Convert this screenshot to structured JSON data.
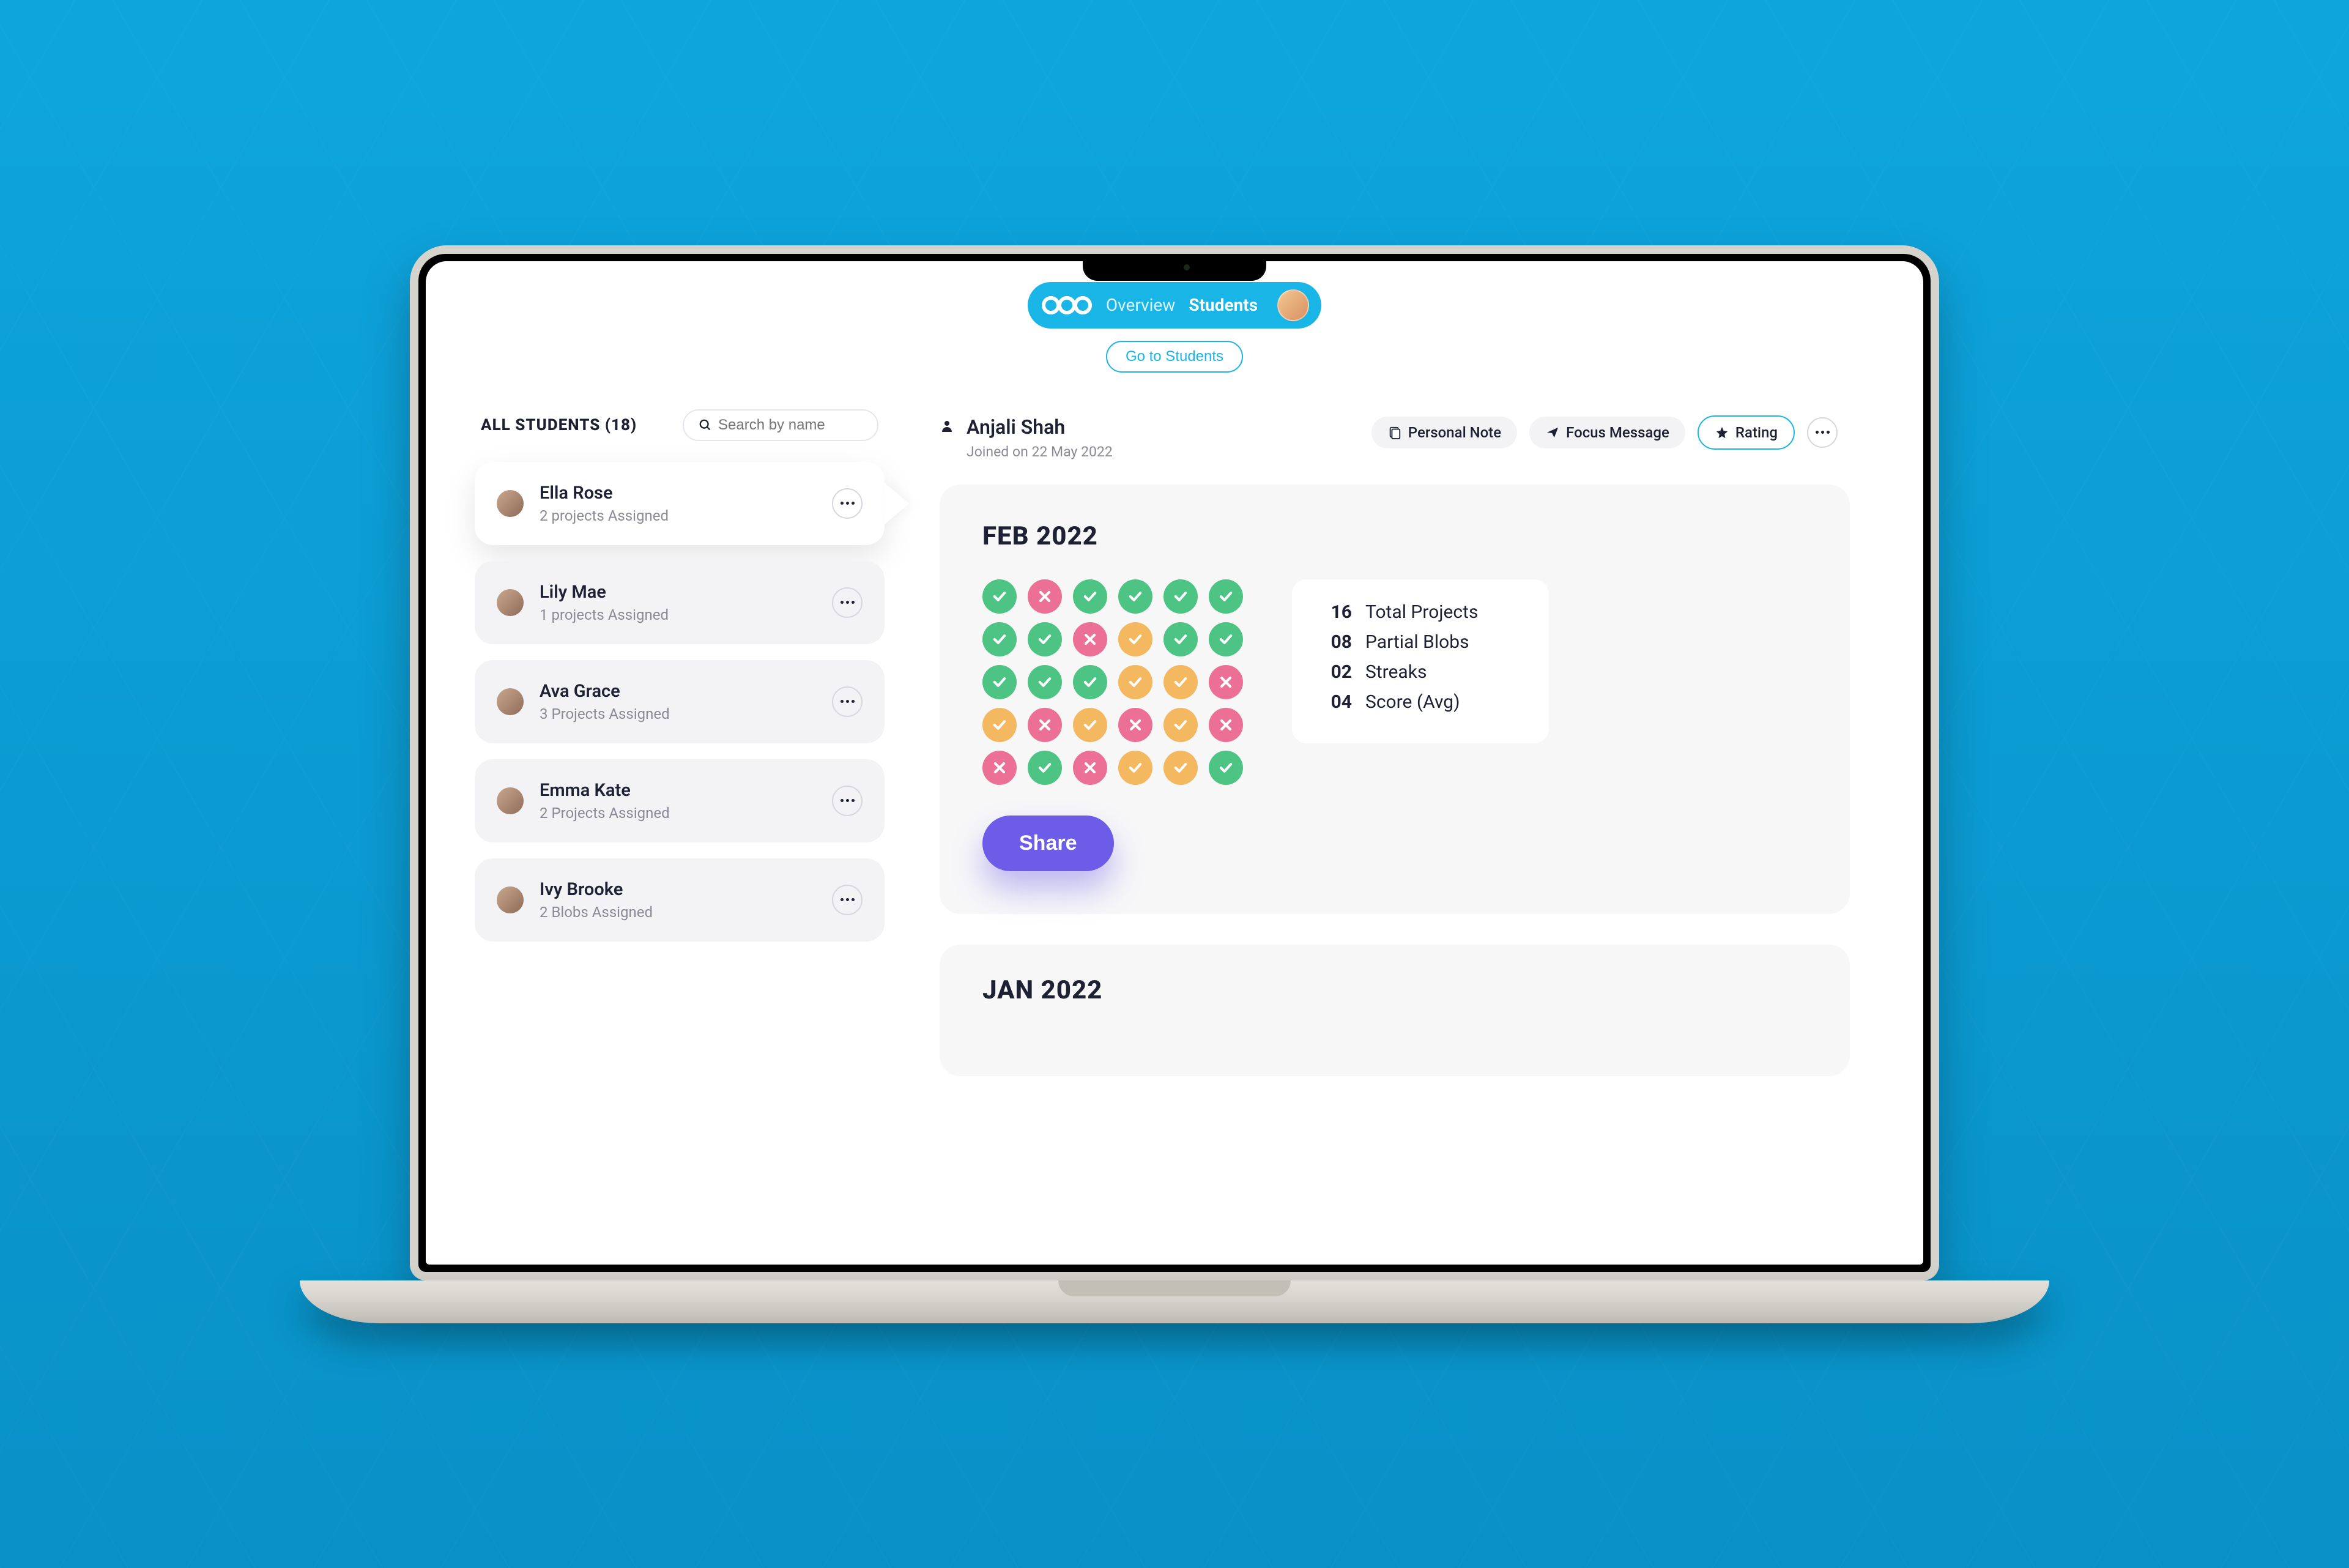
{
  "nav": {
    "tabs": [
      "Overview",
      "Students"
    ],
    "active_index": 1,
    "sub_button": "Go to Students"
  },
  "sidebar": {
    "title_prefix": "ALL STUDENTS",
    "count": 18,
    "search_placeholder": "Search by name",
    "students": [
      {
        "name": "Ella Rose",
        "subtitle": "2 projects Assigned",
        "active": true
      },
      {
        "name": "Lily Mae",
        "subtitle": "1 projects Assigned",
        "active": false
      },
      {
        "name": "Ava Grace",
        "subtitle": "3 Projects Assigned",
        "active": false
      },
      {
        "name": "Emma Kate",
        "subtitle": "2 Projects Assigned",
        "active": false
      },
      {
        "name": "Ivy Brooke",
        "subtitle": "2 Blobs Assigned",
        "active": false
      }
    ]
  },
  "detail": {
    "name": "Anjali Shah",
    "joined": "Joined on 22 May 2022",
    "actions": {
      "personal_note": "Personal Note",
      "focus_message": "Focus Message",
      "rating": "Rating"
    },
    "month": {
      "title": "FEB 2022",
      "grid": [
        "g",
        "p",
        "g",
        "g",
        "g",
        "g",
        "g",
        "g",
        "p",
        "o",
        "g",
        "g",
        "g",
        "g",
        "g",
        "o",
        "o",
        "p",
        "o",
        "p",
        "o",
        "p",
        "o",
        "p",
        "p",
        "g",
        "p",
        "o",
        "o",
        "g"
      ],
      "stats": [
        {
          "num": "16",
          "label": "Total Projects"
        },
        {
          "num": "08",
          "label": "Partial Blobs"
        },
        {
          "num": "02",
          "label": "Streaks"
        },
        {
          "num": "04",
          "label": "Score (Avg)"
        }
      ],
      "share_label": "Share"
    },
    "next_month_title": "JAN 2022"
  }
}
